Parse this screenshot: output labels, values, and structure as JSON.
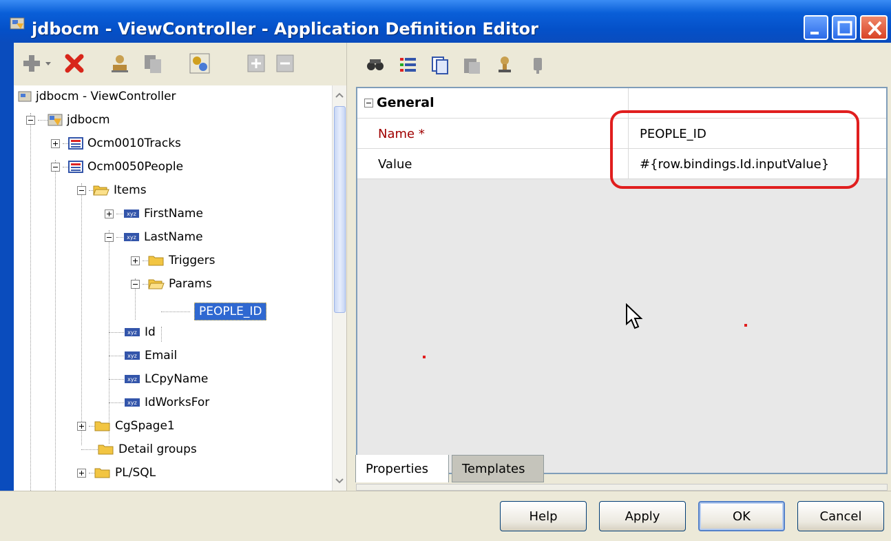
{
  "window": {
    "title": "jdbocm - ViewController - Application Definition Editor",
    "colors": {
      "titlebar": "#0a4cbd",
      "selection": "#2f68d1",
      "highlight": "#e01e1e"
    }
  },
  "left_toolbar": {
    "icons": [
      "add-icon",
      "delete-icon",
      "user-icon",
      "copy-icon",
      "generate-icon",
      "expand-all-icon",
      "collapse-all-icon"
    ]
  },
  "tree": {
    "items": [
      {
        "label": "jdbocm - ViewController"
      },
      {
        "label": "jdbocm"
      },
      {
        "label": "Ocm0010Tracks"
      },
      {
        "label": "Ocm0050People"
      },
      {
        "label": "Items"
      },
      {
        "label": "FirstName"
      },
      {
        "label": "LastName"
      },
      {
        "label": "Triggers"
      },
      {
        "label": "Params"
      },
      {
        "label": "PEOPLE_ID"
      },
      {
        "label": "Id"
      },
      {
        "label": "Email"
      },
      {
        "label": "LCpyName"
      },
      {
        "label": "IdWorksFor"
      },
      {
        "label": "CgSpage1"
      },
      {
        "label": "Detail groups"
      },
      {
        "label": "PL/SQL"
      }
    ]
  },
  "right_toolbar": {
    "icons": [
      "find-icon",
      "list-icon",
      "copy-icon",
      "paste-icon",
      "stamp-icon",
      "pin-icon"
    ]
  },
  "properties": {
    "group": "General",
    "rows": [
      {
        "key": "Name *",
        "value": "PEOPLE_ID",
        "required": true
      },
      {
        "key": "Value",
        "value": "#{row.bindings.Id.inputValue}",
        "required": false
      }
    ]
  },
  "tabs": [
    {
      "label": "Properties",
      "active": true
    },
    {
      "label": "Templates",
      "active": false
    }
  ],
  "buttons": {
    "help": "Help",
    "apply": "Apply",
    "ok": "OK",
    "cancel": "Cancel"
  }
}
